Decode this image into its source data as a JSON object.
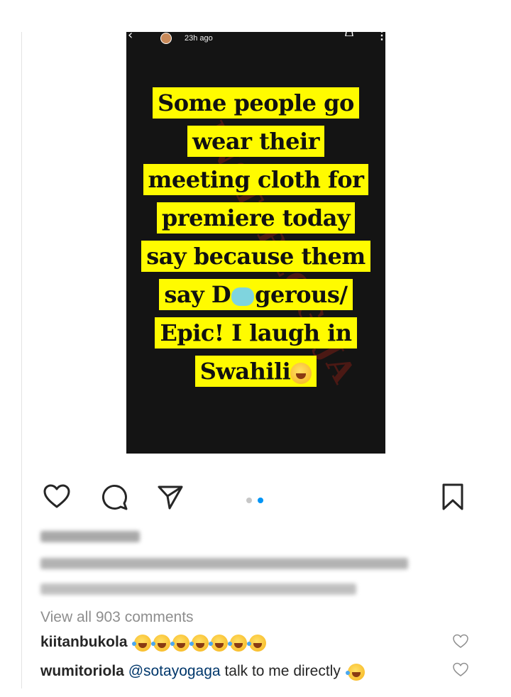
{
  "story": {
    "time": "23h ago",
    "lines": [
      "Some people go",
      "wear their",
      "meeting cloth for",
      "premiere today",
      "say because them"
    ],
    "line6_pre": "say D",
    "line6_post": "gerous/",
    "line7": "Epic!  I laugh in",
    "line8": "Swahili",
    "watermark": "INSTABLOG9JA",
    "emoji": "rolling-on-floor-laughing"
  },
  "actions": {
    "like_icon": "heart-icon",
    "comment_icon": "comment-icon",
    "share_icon": "send-icon",
    "save_icon": "bookmark-icon",
    "carousel_active_index": 2,
    "carousel_total": 2
  },
  "comments": {
    "view_all": "View all 903 comments",
    "items": [
      {
        "user": "kiitanbukola",
        "text": "",
        "emoji_count": 7,
        "emoji": "face-with-tears-of-joy"
      },
      {
        "user": "wumitoriola",
        "mention": "@sotayogaga",
        "text": " talk to me directly",
        "emoji_count": 1,
        "emoji": "face-with-tears-of-joy"
      }
    ]
  },
  "colors": {
    "highlight": "#fffb00",
    "story_bg": "#141414",
    "mention": "#00376b",
    "muted": "#8e8e8e",
    "dot_active": "#0095f6"
  }
}
